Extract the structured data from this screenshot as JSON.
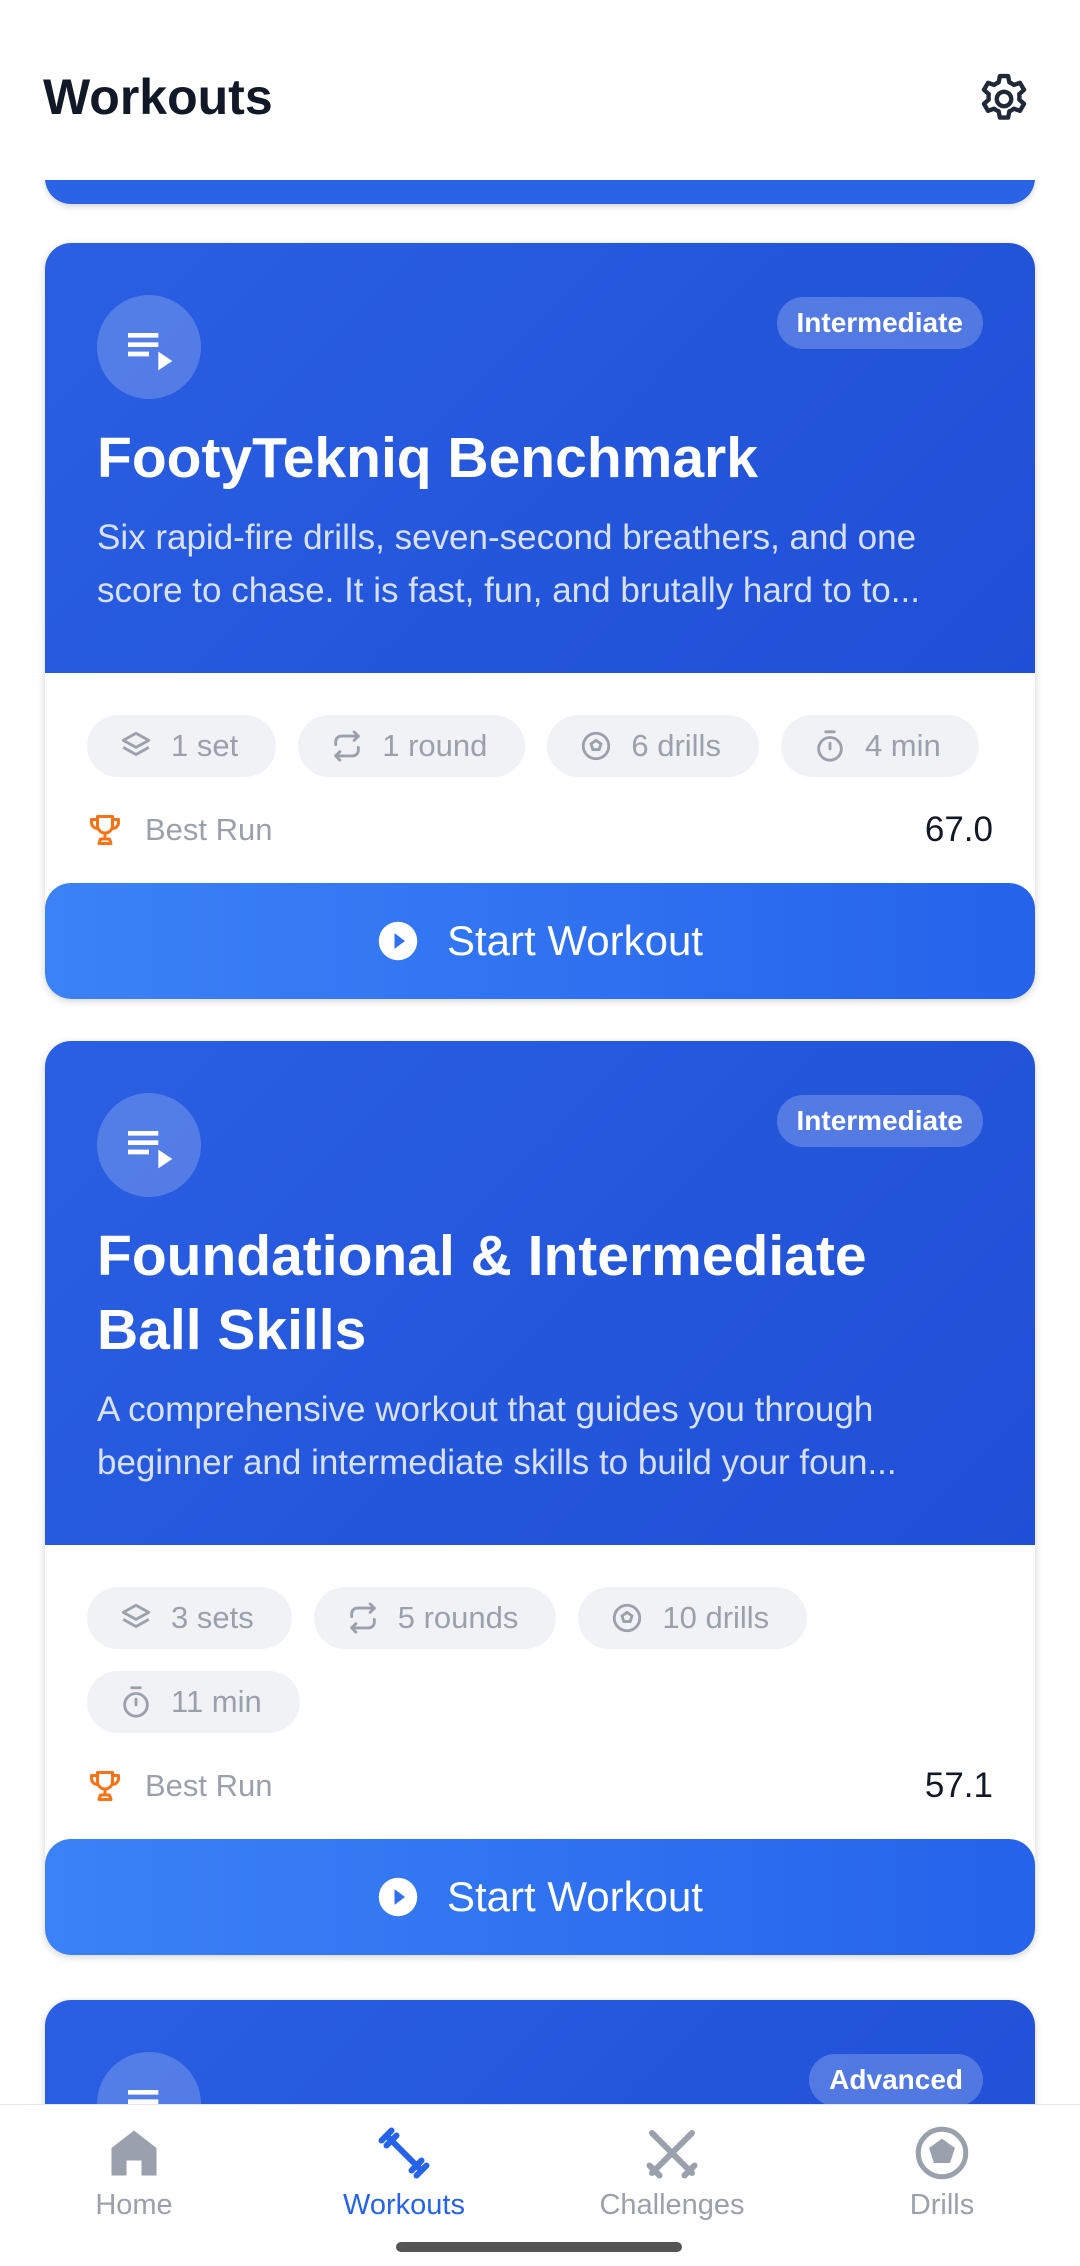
{
  "header": {
    "title": "Workouts"
  },
  "workouts": [
    {
      "level": "Intermediate",
      "title": "FootyTekniq Benchmark",
      "description": "Six rapid-fire drills, seven-second breathers, and one score to chase. It is fast, fun, and brutally hard to to...",
      "stats": [
        "1 set",
        "1 round",
        "6 drills",
        "4 min"
      ],
      "best_label": "Best Run",
      "best_score": "67.0",
      "start_label": "Start Workout"
    },
    {
      "level": "Intermediate",
      "title": "Foundational & Intermediate Ball Skills",
      "description": "A comprehensive workout that guides you through beginner and intermediate skills to build your foun...",
      "stats": [
        "3 sets",
        "5 rounds",
        "10 drills",
        "11 min"
      ],
      "best_label": "Best Run",
      "best_score": "57.1",
      "start_label": "Start Workout"
    },
    {
      "level": "Advanced"
    }
  ],
  "tabs": [
    {
      "label": "Home",
      "icon": "home-icon",
      "active": false
    },
    {
      "label": "Workouts",
      "icon": "dumbbell-icon",
      "active": true
    },
    {
      "label": "Challenges",
      "icon": "crossed-swords-icon",
      "active": false
    },
    {
      "label": "Drills",
      "icon": "soccer-ball-icon",
      "active": false
    }
  ],
  "colors": {
    "accent": "#2563eb",
    "hero": "#2a5fe3",
    "trophy": "#f97316"
  }
}
